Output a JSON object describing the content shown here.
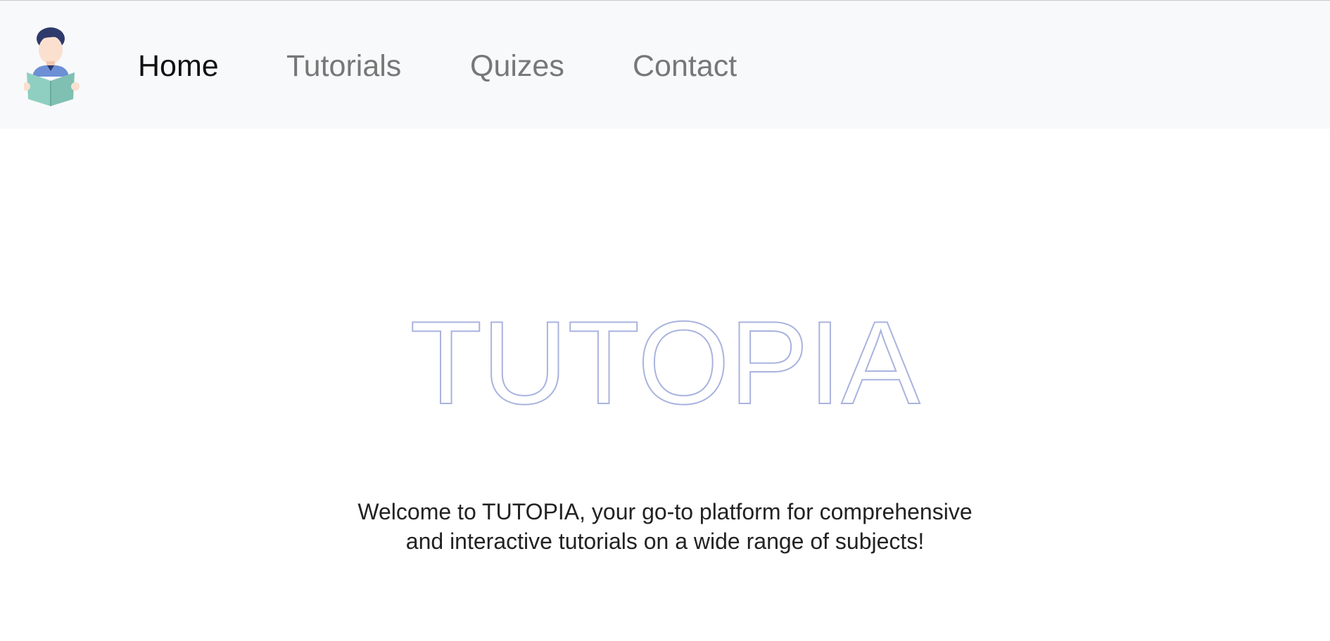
{
  "nav": {
    "logo_icon": "student-reading-book-icon",
    "links": [
      {
        "label": "Home",
        "active": true
      },
      {
        "label": "Tutorials",
        "active": false
      },
      {
        "label": "Quizes",
        "active": false
      },
      {
        "label": "Contact",
        "active": false
      }
    ]
  },
  "hero": {
    "title": "TUTOPIA",
    "title_outline_color": "#a9b3de",
    "welcome_text": "Welcome to TUTOPIA, your go-to platform for comprehensive and interactive tutorials on a wide range of subjects!"
  },
  "colors": {
    "navbar_bg": "#f8f9fa",
    "nav_active": "#111111",
    "nav_inactive": "#777777",
    "body_text": "#222222"
  }
}
